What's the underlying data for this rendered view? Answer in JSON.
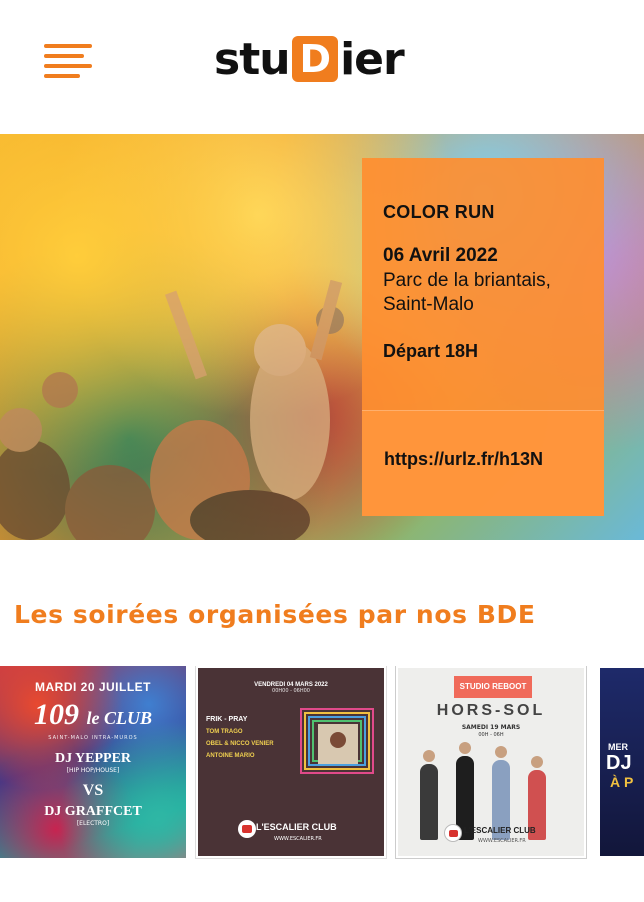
{
  "header": {
    "logo": {
      "prefix": "stu",
      "highlight": "D",
      "suffix": "ier"
    }
  },
  "hero": {
    "title": "COLOR RUN",
    "date": "06 Avril 2022",
    "place_line1": "Parc de la briantais,",
    "place_line2": "Saint-Malo",
    "start": "Départ 18H",
    "link": "https://urlz.fr/h13N"
  },
  "section": {
    "title": "Les soirées organisées par nos BDE"
  },
  "posters": [
    {
      "date": "MARDI 20 JUILLET",
      "venue_number": "109",
      "venue_name": "le CLUB",
      "venue_sub": "SAINT-MALO INTRA-MUROS",
      "dj1": "DJ YEPPER",
      "dj1_genre": "[HIP HOP/HOUSE]",
      "versus": "VS",
      "dj2": "DJ GRAFFCET",
      "dj2_genre": "[ELECTRO]"
    },
    {
      "date": "VENDREDI 04 MARS 2022",
      "time": "00H00 - 06H00",
      "lineup_title": "FRIK - PRAY",
      "artist1": "TOM TRAGO",
      "artist2": "OBEL & NICCO VENIER",
      "artist3": "ANTOINE MARIO",
      "club": "L'ESCALIER CLUB",
      "url": "WWW.ESCALIER.FR"
    },
    {
      "tag": "STUDIO REBOOT",
      "title": "HORS-SOL",
      "date": "SAMEDI 19 MARS",
      "hours": "00H - 06H",
      "club": "L'ESCALIER CLUB",
      "url": "WWW.ESCALIER.FR"
    },
    {
      "line1": "MER",
      "line2": "DJ",
      "line3": "À P"
    }
  ],
  "colors": {
    "accent": "#f07d1e",
    "hero_card": "#ff8e30"
  }
}
